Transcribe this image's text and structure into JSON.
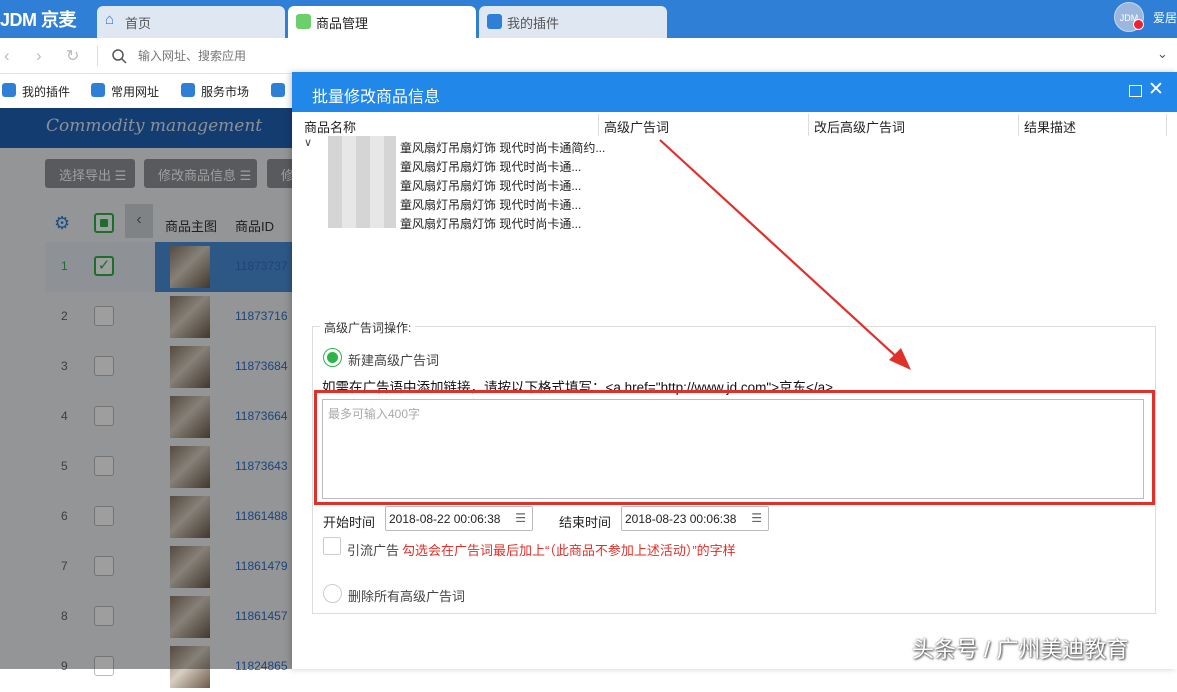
{
  "app": {
    "logo": "JDM 京麦",
    "user_avatar": "JDM",
    "user_name": "爱居"
  },
  "tabs": [
    {
      "label": "首页"
    },
    {
      "label": "商品管理"
    },
    {
      "label": "我的插件"
    }
  ],
  "address_bar": {
    "placeholder": "输入网址、搜索应用"
  },
  "bookmarks": [
    {
      "label": "我的插件"
    },
    {
      "label": "常用网址"
    },
    {
      "label": "服务市场"
    }
  ],
  "background_page": {
    "brand": "Commodity management",
    "toolbar": [
      "选择导出 ☰",
      "修改商品信息 ☰",
      "修"
    ],
    "columns": [
      "商品主图",
      "商品ID"
    ],
    "rows": [
      {
        "n": "1",
        "id": "11873737",
        "checked": true
      },
      {
        "n": "2",
        "id": "11873716"
      },
      {
        "n": "3",
        "id": "11873684"
      },
      {
        "n": "4",
        "id": "11873664"
      },
      {
        "n": "5",
        "id": "11873643"
      },
      {
        "n": "6",
        "id": "11861488"
      },
      {
        "n": "7",
        "id": "11861479"
      },
      {
        "n": "8",
        "id": "11861457"
      },
      {
        "n": "9",
        "id": "11824865"
      }
    ]
  },
  "dialog": {
    "title": "批量修改商品信息",
    "table_headers": [
      "商品名称",
      "高级广告词",
      "改后高级广告词",
      "结果描述"
    ],
    "products": [
      "童风扇灯吊扇灯饰 现代时尚卡通简约...",
      "童风扇灯吊扇灯饰 现代时尚卡通...",
      "童风扇灯吊扇灯饰 现代时尚卡通...",
      "童风扇灯吊扇灯饰 现代时尚卡通...",
      "童风扇灯吊扇灯饰 现代时尚卡通..."
    ],
    "section_label": "高级广告词操作:",
    "radio_new": "新建高级广告词",
    "hint": "如需在广告语中添加链接，请按以下格式填写：<a href=\"http://www.jd.com\">京东</a>",
    "textarea_placeholder": "最多可输入400字",
    "start_label": "开始时间",
    "start_value": "2018-08-22 00:06:38",
    "end_label": "结束时间",
    "end_value": "2018-08-23 00:06:38",
    "traffic_label": "引流广告",
    "traffic_warning": "勾选会在广告词最后加上“（此商品不参加上述活动）”的字样",
    "radio_delete": "删除所有高级广告词"
  },
  "watermark": "头条号 / 广州美迪教育",
  "colors": {
    "title_bar": "#2f7fd6",
    "dialog_header": "#2187e8",
    "highlight": "#e0302a",
    "radio_on": "#2db34a"
  }
}
